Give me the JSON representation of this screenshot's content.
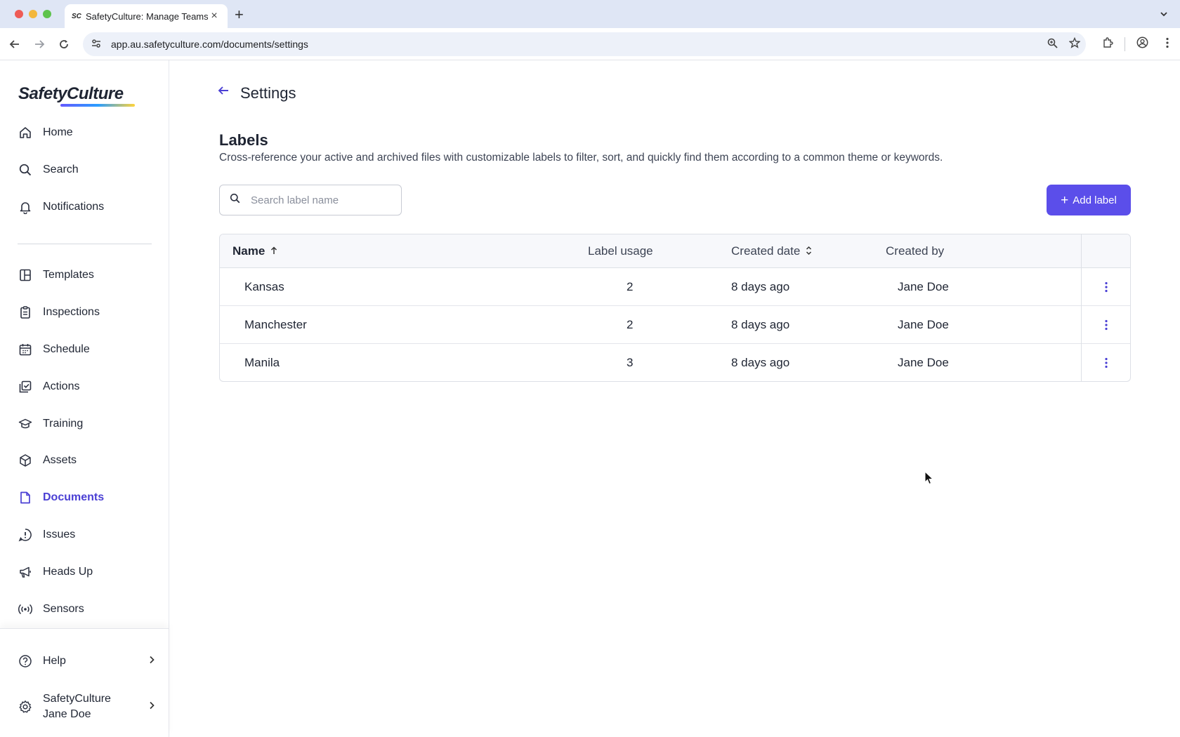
{
  "browser": {
    "tab_title": "SafetyCulture: Manage Teams",
    "tab_favicon": "SC",
    "url": "app.au.safetyculture.com/documents/settings"
  },
  "sidebar": {
    "logo": "SafetyCulture",
    "items": [
      {
        "label": "Home",
        "icon": "home-icon"
      },
      {
        "label": "Search",
        "icon": "search-icon"
      },
      {
        "label": "Notifications",
        "icon": "bell-icon"
      },
      {
        "label": "Templates",
        "icon": "templates-icon"
      },
      {
        "label": "Inspections",
        "icon": "clipboard-icon"
      },
      {
        "label": "Schedule",
        "icon": "calendar-icon"
      },
      {
        "label": "Actions",
        "icon": "checkbox-icon"
      },
      {
        "label": "Training",
        "icon": "graduation-cap-icon"
      },
      {
        "label": "Assets",
        "icon": "cube-icon"
      },
      {
        "label": "Documents",
        "icon": "document-icon",
        "active": true
      },
      {
        "label": "Issues",
        "icon": "alert-icon"
      },
      {
        "label": "Heads Up",
        "icon": "megaphone-icon"
      },
      {
        "label": "Sensors",
        "icon": "sensor-icon"
      }
    ],
    "help_label": "Help",
    "org_name": "SafetyCulture",
    "user_name": "Jane Doe"
  },
  "page": {
    "title": "Settings",
    "section_title": "Labels",
    "section_description": "Cross-reference your active and archived files with customizable labels to filter, sort, and quickly find them according to a common theme or keywords.",
    "search_placeholder": "Search label name",
    "add_label": "Add label"
  },
  "table": {
    "headers": {
      "name": "Name",
      "usage": "Label usage",
      "created_date": "Created date",
      "created_by": "Created by"
    },
    "rows": [
      {
        "name": "Kansas",
        "usage": "2",
        "created_date": "8 days ago",
        "created_by": "Jane Doe"
      },
      {
        "name": "Manchester",
        "usage": "2",
        "created_date": "8 days ago",
        "created_by": "Jane Doe"
      },
      {
        "name": "Manila",
        "usage": "3",
        "created_date": "8 days ago",
        "created_by": "Jane Doe"
      }
    ]
  },
  "colors": {
    "accent": "#5b4eea",
    "active_nav": "#4a3fd4"
  }
}
